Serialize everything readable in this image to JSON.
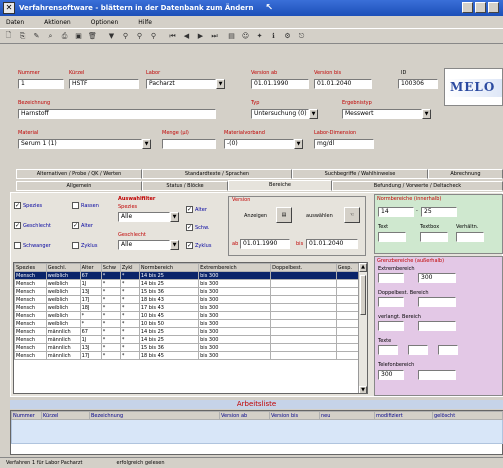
{
  "window": {
    "title": "Verfahrensoftware - blättern in der Datenbank zum Ändern"
  },
  "menu": [
    "Daten",
    "Aktionen",
    "Optionen",
    "Hilfe"
  ],
  "header": {
    "nummer": {
      "label": "Nummer",
      "value": "1"
    },
    "kuerzel": {
      "label": "Kürzel",
      "value": "HSTF"
    },
    "labor": {
      "label": "Labor",
      "value": "Pacharzt"
    },
    "version_ab": {
      "label": "Version ab",
      "value": "01.01.1990"
    },
    "version_bis": {
      "label": "Version bis",
      "value": "01.01.2040"
    },
    "id": {
      "label": "ID",
      "value": "100306"
    },
    "logo_text": "MELO",
    "bezeichnung": {
      "label": "Bezeichnung",
      "value": "Harnstoff"
    },
    "typ": {
      "label": "Typ",
      "value": "Untersuchung (0)"
    },
    "ergebnistyp": {
      "label": "Ergebnistyp",
      "value": "Messwert"
    },
    "material": {
      "label": "Material",
      "value": "Serum 1 (1)"
    },
    "menge": {
      "label": "Menge (µl)",
      "value": ""
    },
    "materialvorbehand": {
      "label": "Materialvorband",
      "value": "-(0)"
    },
    "labor_dimension": {
      "label": "Labor-Dimension",
      "value": "mg/dl"
    }
  },
  "tabs_row1": [
    "Alternativen / Probe / QK / Werten",
    "Standardtexte / Sprachen",
    "Suchbegriffe / Wahlhinweise",
    "Abrechnung"
  ],
  "tabs_row2": [
    "Allgemein",
    "Status / Blöcke",
    "Bereiche",
    "Befundung / Vorwerte / Deltacheck"
  ],
  "filter": {
    "spezies": "Spezies",
    "rassen": "Rassen",
    "geschlecht": "Geschlecht",
    "alter": "Alter",
    "schwanger": "Schwanger",
    "zyklus": "Zyklus",
    "auswahl_title": "Auswahlfilter",
    "spezies_label": "Spezies",
    "spezies_value": "Alle",
    "geschlecht_label": "Geschlecht",
    "geschlecht_value": "Alle",
    "alter_cb": "Alter",
    "schw_cb": "Schw.",
    "zyklus_cb": "Zyklus"
  },
  "version_box": {
    "title": "Version",
    "anzeigen": "Anzeigen",
    "auswaehlen": "auswählen",
    "ab_label": "ab",
    "ab_value": "01.01.1990",
    "bis_label": "bis",
    "bis_value": "01.01.2040"
  },
  "normal": {
    "title": "Normbereiche (innerhalb)",
    "from": "14",
    "to": "25",
    "text_label": "Text",
    "textbox_label": "Textbox",
    "verhaelt_label": "Verhältn."
  },
  "grenz": {
    "title": "Grenzbereiche (außerhalb)",
    "extrem_label": "Extrembereich",
    "extrem_value": "300",
    "doppel_label": "Doppelbest. Bereich",
    "verlang_label": "verlangt. Bereich",
    "texte_label": "Texte",
    "telefon_label": "Telefonbereich",
    "telefon_value": "300"
  },
  "table": {
    "headers": [
      "Spezies",
      "Geschl.",
      "Alter",
      "Schw",
      "Zykl",
      "Normbereich",
      "Extrembereich",
      "Doppelbest.",
      "Gesp."
    ],
    "rows": [
      [
        "Mensch",
        "weiblich",
        "67",
        "*",
        "*",
        "14 bis 25",
        "bis 300",
        "",
        ""
      ],
      [
        "Mensch",
        "weiblich",
        "1J",
        "*",
        "*",
        "14 bis 25",
        "bis 300",
        "",
        ""
      ],
      [
        "Mensch",
        "weiblich",
        "13J",
        "*",
        "*",
        "15 bis 36",
        "bis 300",
        "",
        ""
      ],
      [
        "Mensch",
        "weiblich",
        "17J",
        "*",
        "*",
        "18 bis 43",
        "bis 300",
        "",
        ""
      ],
      [
        "Mensch",
        "weiblich",
        "18J",
        "*",
        "*",
        "17 bis 43",
        "bis 300",
        "",
        ""
      ],
      [
        "Mensch",
        "weiblich",
        "*",
        "*",
        "*",
        "10 bis 45",
        "bis 300",
        "",
        ""
      ],
      [
        "Mensch",
        "weiblich",
        "*",
        "*",
        "*",
        "10 bis 50",
        "bis 300",
        "",
        ""
      ],
      [
        "Mensch",
        "männlich",
        "67",
        "*",
        "*",
        "14 bis 25",
        "bis 300",
        "",
        ""
      ],
      [
        "Mensch",
        "männlich",
        "1J",
        "*",
        "*",
        "14 bis 25",
        "bis 300",
        "",
        ""
      ],
      [
        "Mensch",
        "männlich",
        "13J",
        "*",
        "*",
        "15 bis 36",
        "bis 300",
        "",
        ""
      ],
      [
        "Mensch",
        "männlich",
        "17J",
        "*",
        "*",
        "18 bis 45",
        "bis 300",
        "",
        ""
      ]
    ]
  },
  "arbeitsliste": {
    "title": "Arbeitsliste",
    "headers": [
      "Nummer",
      "Kürzel",
      "Bezeichnung",
      "Version ab",
      "Version bis",
      "neu",
      "modifiziert",
      "gelöscht"
    ]
  },
  "status": {
    "left": "Verfahren 1 für Labor Pacharzt",
    "right": "erfolgreich gelesen"
  },
  "colors": {
    "title": "#1c4fb8",
    "accent_label": "#c00000",
    "selection": "#0a246a",
    "norm_bg": "#cfe8cf",
    "grenz_bg": "#e3c8e6",
    "field_yellow": "#ffff99"
  }
}
